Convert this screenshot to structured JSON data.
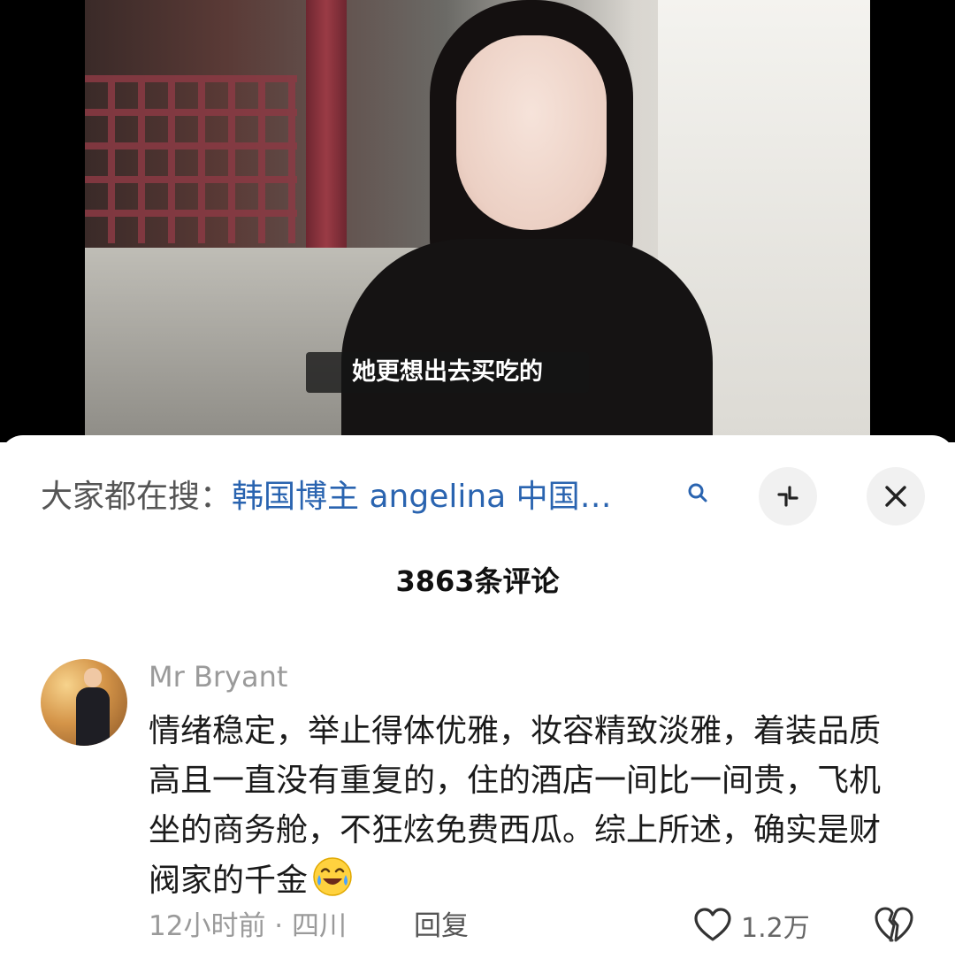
{
  "video": {
    "subtitle": "她更想出去买吃的"
  },
  "search_bar": {
    "prefix": "大家都在搜：",
    "term": "韩国博主 angelina 中国…"
  },
  "comments": {
    "count_label": "3863条评论",
    "items": [
      {
        "author": "Mr Bryant",
        "text": "情绪稳定，举止得体优雅，妆容精致淡雅，着装品质高且一直没有重复的，住的酒店一间比一间贵，飞机坐的商务舱，不狂炫免费西瓜。综上所述，确实是财阀家的千金",
        "emoji_icon": "laughing-tears-icon",
        "meta": "12小时前 · 四川",
        "reply_label": "回复",
        "like_count": "1.2万"
      }
    ]
  },
  "icons": {
    "search": "search-icon",
    "expand": "collapse-arrows-icon",
    "close": "close-icon",
    "like": "heart-icon",
    "dislike": "broken-heart-icon"
  },
  "colors": {
    "link_blue": "#2a64b0",
    "muted_gray": "#9a9a9a",
    "button_bg": "#f1f1f1"
  }
}
